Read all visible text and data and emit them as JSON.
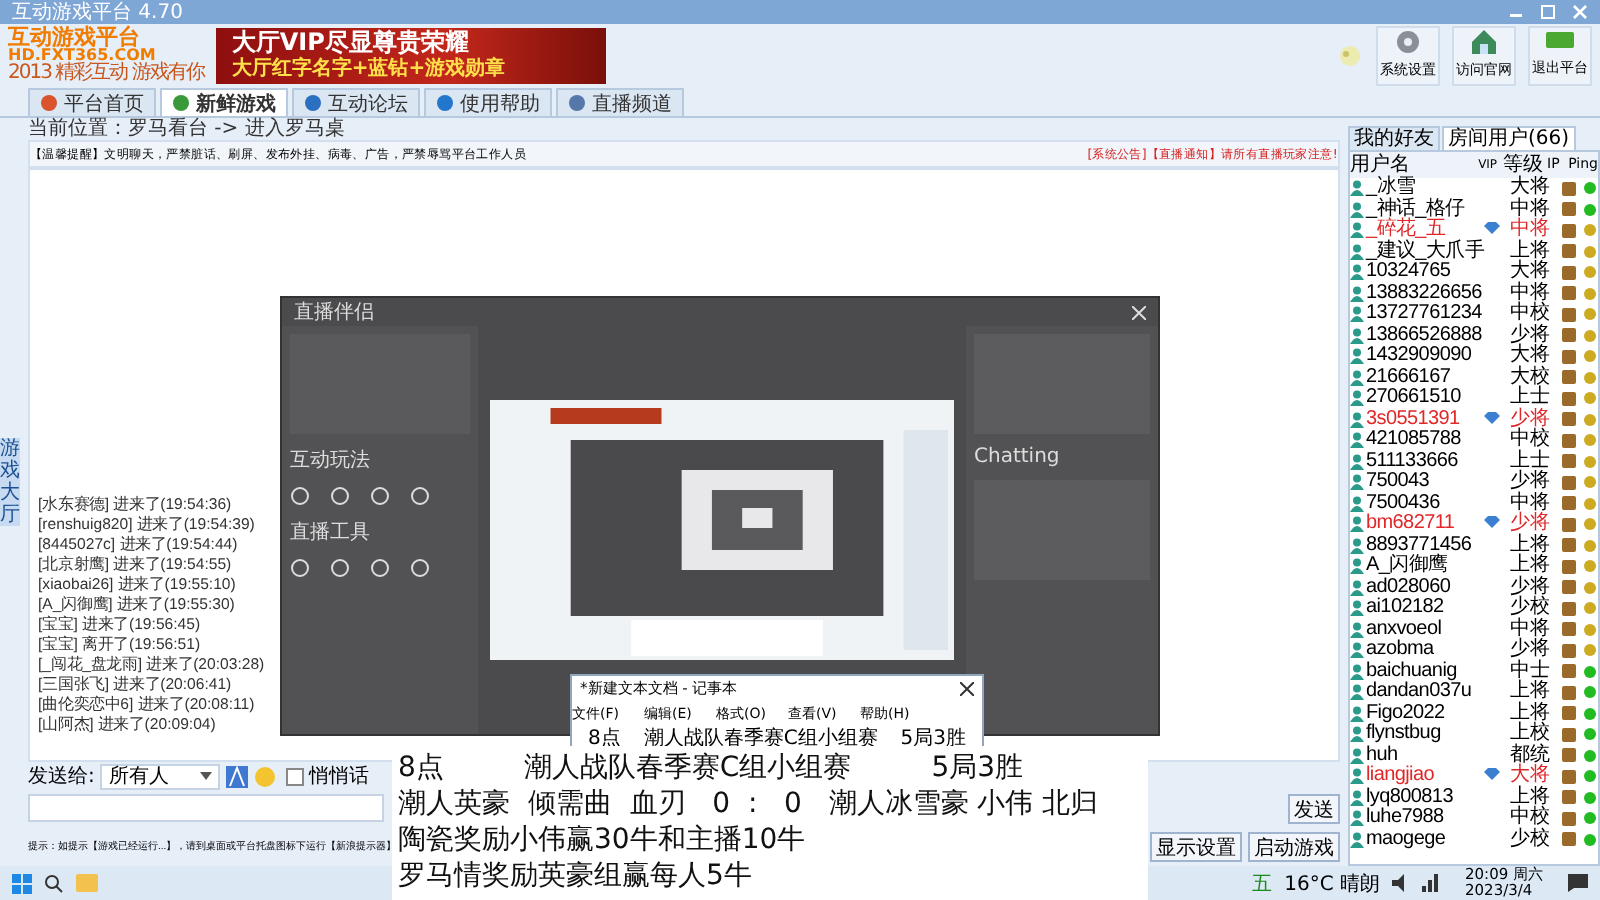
{
  "window": {
    "title": "互动游戏平台 4.70"
  },
  "logo": {
    "name": "互动游戏平台",
    "url": "HD.FXT365.COM",
    "slogan": "2013 精彩互动 游戏有你"
  },
  "banner": {
    "headline": "大厅VIP尽显尊贵荣耀",
    "subline": "大厅红字名字+蓝钻+游戏勋章"
  },
  "toolbar_buttons": [
    {
      "label": "系统设置",
      "kind": "gear"
    },
    {
      "label": "访问官网",
      "kind": "house"
    },
    {
      "label": "退出平台",
      "kind": "exit"
    }
  ],
  "tabs": [
    {
      "label": "平台首页",
      "kind": "home",
      "selected": false
    },
    {
      "label": "新鲜游戏",
      "kind": "chat",
      "selected": true
    },
    {
      "label": "互动论坛",
      "kind": "sync",
      "selected": false
    },
    {
      "label": "使用帮助",
      "kind": "help",
      "selected": false
    },
    {
      "label": "直播频道",
      "kind": "globe",
      "selected": false
    }
  ],
  "breadcrumb": "当前位置：罗马看台 -> 进入罗马桌",
  "notice": "【温馨提醒】文明聊天，严禁脏话、刷屏、发布外挂、病毒、广告，严禁辱骂平台工作人员",
  "announcement": "[系统公告]【直播通知】请所有直播玩家注意!",
  "side_tab": "游戏大厅",
  "chat": [
    {
      "user": "[水东赛德]",
      "text": "进来了(19:54:36)"
    },
    {
      "user": "[renshuig820]",
      "text": "进来了(19:54:39)"
    },
    {
      "user": "[8445027c]",
      "text": "进来了(19:54:44)"
    },
    {
      "user": "[北京射鹰]",
      "text": "进来了(19:54:55)"
    },
    {
      "user": "[xiaobai26]",
      "text": "进来了(19:55:10)"
    },
    {
      "user": "[A_闪御鹰]",
      "text": "进来了(19:55:30)"
    },
    {
      "user": "[宝宝]",
      "text": "进来了(19:56:45)"
    },
    {
      "user": "[宝宝]",
      "text": "离开了(19:56:51)"
    },
    {
      "user": "[_闯花_盘龙雨]",
      "text": "进来了(20:03:28)"
    },
    {
      "user": "[三国张飞]",
      "text": "进来了(20:06:41)"
    },
    {
      "user": "[曲伦奕恋中6]",
      "text": "进来了(20:08:11)"
    },
    {
      "user": "[山阿杰]",
      "text": "进来了(20:09:04)"
    }
  ],
  "composer": {
    "send_to_label": "发送给:",
    "recipient": "所有人",
    "whisper": {
      "label": "悄悄话",
      "checked": false
    }
  },
  "tip": "提示：如提示【游戏已经运行...】，请到桌面或平台托盘图标下运行【新浪提示器】",
  "buttons": [
    {
      "label": "发送"
    },
    {
      "label": "显示设置"
    },
    {
      "label": "启动游戏"
    }
  ],
  "user_panel": {
    "tabs": [
      {
        "label": "我的好友",
        "selected": false
      },
      {
        "label": "房间用户(66)",
        "selected": true
      }
    ],
    "columns": [
      "用户名",
      "VIP",
      "等级",
      "IP",
      "Ping"
    ],
    "rows": [
      {
        "name": "_冰雪",
        "vip": false,
        "rank": "大将",
        "color": "#22bb22"
      },
      {
        "name": "_神话_格仔",
        "vip": false,
        "rank": "中将",
        "color": "#22bb22"
      },
      {
        "name": "_碎花_五",
        "vip": true,
        "rank": "中将",
        "color": "#ccaa22"
      },
      {
        "name": "_建议_大爪手",
        "vip": false,
        "rank": "上将",
        "color": "#ccaa22"
      },
      {
        "name": "10324765",
        "vip": false,
        "rank": "大将",
        "color": "#ccaa22"
      },
      {
        "name": "13883226656",
        "vip": false,
        "rank": "中将",
        "color": "#ccaa22"
      },
      {
        "name": "13727761234",
        "vip": false,
        "rank": "中校",
        "color": "#ccaa22"
      },
      {
        "name": "13866526888",
        "vip": false,
        "rank": "少将",
        "color": "#ccaa22"
      },
      {
        "name": "1432909090",
        "vip": false,
        "rank": "大将",
        "color": "#ccaa22"
      },
      {
        "name": "21666167",
        "vip": false,
        "rank": "大校",
        "color": "#ccaa22"
      },
      {
        "name": "270661510",
        "vip": false,
        "rank": "上士",
        "color": "#ccaa22"
      },
      {
        "name": "3s0551391",
        "vip": true,
        "rank": "少将",
        "color": "#ccaa22"
      },
      {
        "name": "421085788",
        "vip": false,
        "rank": "中校",
        "color": "#ccaa22"
      },
      {
        "name": "511133666",
        "vip": false,
        "rank": "上士",
        "color": "#ccaa22"
      },
      {
        "name": "750043",
        "vip": false,
        "rank": "少将",
        "color": "#ccaa22"
      },
      {
        "name": "7500436",
        "vip": false,
        "rank": "中将",
        "color": "#ccaa22"
      },
      {
        "name": "bm682711",
        "vip": true,
        "rank": "少将",
        "color": "#ccaa22"
      },
      {
        "name": "8893771456",
        "vip": false,
        "rank": "上将",
        "color": "#ccaa22"
      },
      {
        "name": "A_闪御鹰",
        "vip": false,
        "rank": "上将",
        "color": "#ccaa22"
      },
      {
        "name": "ad028060",
        "vip": false,
        "rank": "少将",
        "color": "#ccaa22"
      },
      {
        "name": "ai102182",
        "vip": false,
        "rank": "少校",
        "color": "#ccaa22"
      },
      {
        "name": "anxvoeol",
        "vip": false,
        "rank": "中将",
        "color": "#ccaa22"
      },
      {
        "name": "azobma",
        "vip": false,
        "rank": "少将",
        "color": "#ccaa22"
      },
      {
        "name": "baichuanig",
        "vip": false,
        "rank": "中士",
        "color": "#22bb22"
      },
      {
        "name": "dandan037u",
        "vip": false,
        "rank": "上将",
        "color": "#22bb22"
      },
      {
        "name": "Figo2022",
        "vip": false,
        "rank": "上将",
        "color": "#22bb22"
      },
      {
        "name": "flynstbug",
        "vip": false,
        "rank": "上校",
        "color": "#22bb22"
      },
      {
        "name": "huh",
        "vip": false,
        "rank": "都统",
        "color": "#22bb22"
      },
      {
        "name": "liangjiao",
        "vip": true,
        "rank": "大将",
        "color": "#22bb22"
      },
      {
        "name": "lyq800813",
        "vip": false,
        "rank": "上将",
        "color": "#22bb22"
      },
      {
        "name": "luhe7988",
        "vip": false,
        "rank": "中校",
        "color": "#22bb22"
      },
      {
        "name": "maogege",
        "vip": false,
        "rank": "少校",
        "color": "#22bb22"
      }
    ]
  },
  "streaming_app": {
    "title": "直播伴侣",
    "sections": [
      "互动玩法",
      "直播工具"
    ],
    "right_title": "Chatting"
  },
  "notepad": {
    "title": "*新建文本文档 - 记事本",
    "menu": [
      "文件(F)",
      "编辑(E)",
      "格式(O)",
      "查看(V)",
      "帮助(H)"
    ],
    "line": [
      "8点",
      "潮人战队春季赛C组小组赛",
      "5局3胜"
    ]
  },
  "notepad_zoom": {
    "first_line": [
      "8点",
      "潮人战队春季赛C组小组赛",
      "5局3胜"
    ],
    "lines": [
      "潮人英豪  倾需曲  血刃   0  :   0   潮人冰雪豪 小伟 北归",
      "陶瓷奖励小伟赢30牛和主播10牛",
      "罗马情奖励英豪组赢每人5牛"
    ]
  },
  "taskbar": {
    "ime": "五",
    "weather": "16°C 晴朗",
    "time": "20:09 周六",
    "date": "2023/3/4"
  }
}
